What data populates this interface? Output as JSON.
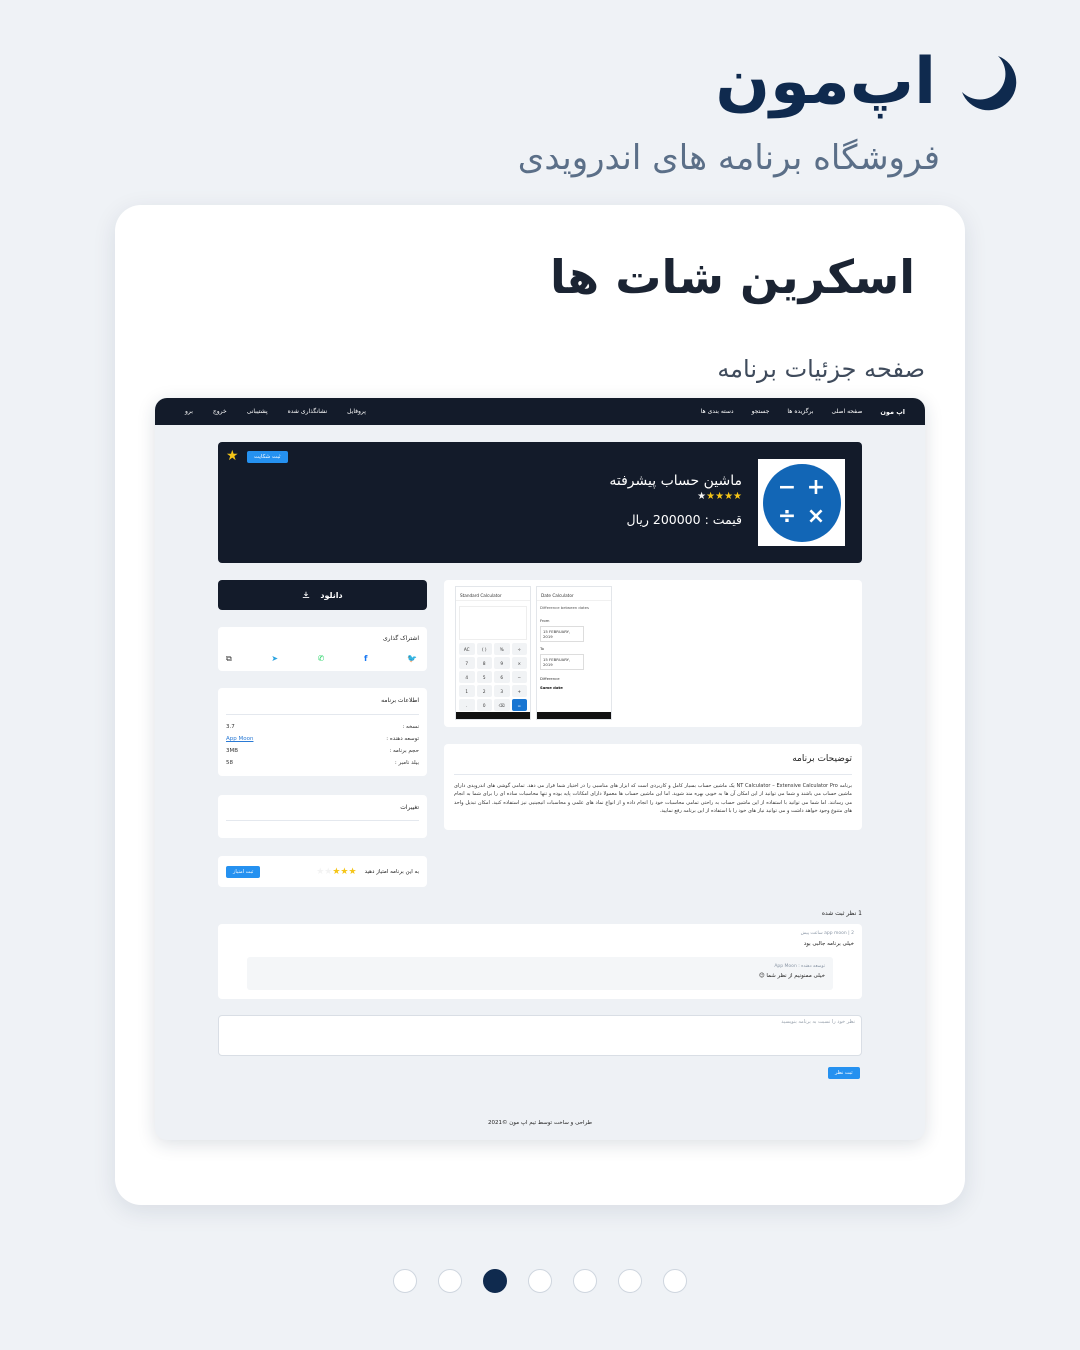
{
  "brand": {
    "name": "اپ‌مون",
    "tagline": "فروشگاه برنامه های اندرویدی"
  },
  "card": {
    "title": "اسکرین شات ها",
    "subtitle": "صفحه جزئیات برنامه"
  },
  "nav": {
    "logo": "اپ مون",
    "items": [
      "صفحه اصلی",
      "برگزیده ها",
      "جستجو",
      "دسته بندی ها"
    ],
    "left_items": [
      "پروفایل",
      "نشانگذاری شده",
      "پشتیبانی",
      "خروج",
      "برو"
    ]
  },
  "app": {
    "name": "ماشین حساب پیشرفته",
    "price": "قیمت : 200000 ریال",
    "rating": 4,
    "rating_max": 5,
    "icon_symbols": [
      "+",
      "−",
      "×",
      "÷"
    ],
    "report_label": "ثبت شکایت"
  },
  "download": {
    "label": "دانلود"
  },
  "share": {
    "title": "اشتراک گذاری",
    "icons": [
      "twitter-icon",
      "facebook-icon",
      "whatsapp-icon",
      "telegram-icon",
      "copy-icon"
    ]
  },
  "info": {
    "title": "اطلاعات برنامه",
    "rows": [
      {
        "label": "نسخه :",
        "value": "3.7"
      },
      {
        "label": "توسعه دهنده :",
        "value": "App Moon"
      },
      {
        "label": "حجم برنامه :",
        "value": "3MB"
      },
      {
        "label": "بیلد نامبر :",
        "value": "58"
      }
    ]
  },
  "changes": {
    "title": "تغییرات"
  },
  "rate": {
    "prompt": "به این برنامه امتیاز دهید",
    "stars": 3,
    "button": "ثبت امتیاز"
  },
  "screenshots": {
    "standard": {
      "title": "Standard Calculator",
      "keys": [
        "AC",
        "( )",
        "%",
        "÷",
        "7",
        "8",
        "9",
        "×",
        "4",
        "5",
        "6",
        "−",
        "1",
        "2",
        "3",
        "+",
        ".",
        "0",
        "⌫",
        "="
      ]
    },
    "date": {
      "title": "Date Calculator",
      "mode": "Difference between dates",
      "from_label": "From",
      "from_value": "15 FEBRUARY, 2019",
      "to_label": "To",
      "to_value": "15 FEBRUARY, 2019",
      "diff_label": "Difference",
      "diff_value": "Same date"
    }
  },
  "description": {
    "title": "توضیحات برنامه",
    "body": "برنامه NT Calculator – Extensive Calculator Pro یک ماشین حساب بسیار کامل و کاربردی است که ابزار های مناسبی را در اختیار شما قرار می دهد. تمامی گوشی های اندرویدی دارای ماشین حساب می باشند و شما می توانید از این امکان آن ها به خوبی بهره مند شوید. اما این ماشین حساب ها معمولا دارای امکانات پایه بوده و تنها محاسبات ساده ای را برای شما به انجام می رسانند. اما شما می توانید با استفاده از این ماشین حساب به راحتی تمامی محاسبات خود را انجام داده و از انواع نماد های علمی و محاسبات انیجینیی نیز استفاده کنید. امکان تبدیل واحد های متنوع وجود خواهد داشت و می توانید نیاز های خود را با استفاده از این برنامه رفع نمایید."
  },
  "comments": {
    "count_label": "1 نظر ثبت شده",
    "items": [
      {
        "meta": "app moon | 2 ساعت پیش",
        "text": "خیلی برنامه جالبی بود",
        "reply_meta": "توسعه دهنده : App Moon",
        "reply_text": "خیلی ممنونیم از نظر شما 😊"
      }
    ],
    "input_placeholder": "نظر خود را نسبت به برنامه بنویسید",
    "submit": "ثبت نظر"
  },
  "footer": {
    "text": "طراحی و ساخت توسط تیم اپ مون ©2021"
  },
  "pagination": {
    "total": 7,
    "active_index": 2
  },
  "colors": {
    "brand": "#0f2a4e",
    "dark": "#131b2a",
    "accent": "#2591f0",
    "star": "#f5c518"
  }
}
